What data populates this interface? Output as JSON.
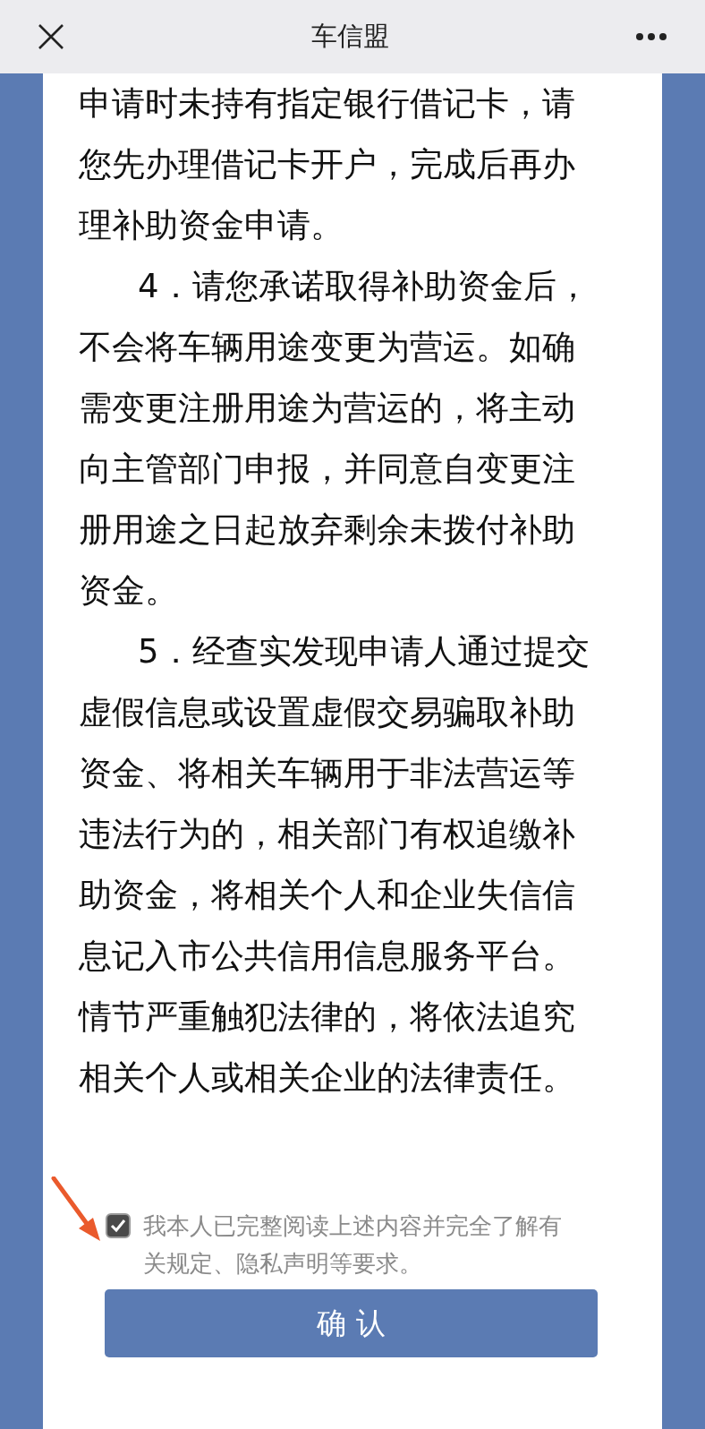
{
  "nav_bar": {
    "title": "车信盟"
  },
  "paragraphs": [
    {
      "lines": [
        "申请时未持有指定银行借记卡，请",
        "您先办理借记卡开户，完成后再办",
        "理补助资金申请。"
      ],
      "indent": false
    },
    {
      "lines": [
        "4．请您承诺取得补助资金后，",
        "不会将车辆用途变更为营运。如确",
        "需变更注册用途为营运的，将主动",
        "向主管部门申报，并同意自变更注",
        "册用途之日起放弃剩余未拨付补助",
        "资金。"
      ],
      "indent": true
    },
    {
      "lines": [
        "5．经查实发现申请人通过提交",
        "虚假信息或设置虚假交易骗取补助",
        "资金、将相关车辆用于非法营运等",
        "违法行为的，相关部门有权追缴补",
        "助资金，将相关个人和企业失信信",
        "息记入市公共信用信息服务平台。",
        "情节严重触犯法律的，将依法追究",
        "相关个人或相关企业的法律责任。"
      ],
      "indent": true
    }
  ],
  "agreement": {
    "checked": true,
    "lines": [
      "我本人已完整阅读上述内容并完全了解有",
      "关规定、隐私声明等要求。"
    ]
  },
  "confirm_button": {
    "label": "确 认"
  }
}
